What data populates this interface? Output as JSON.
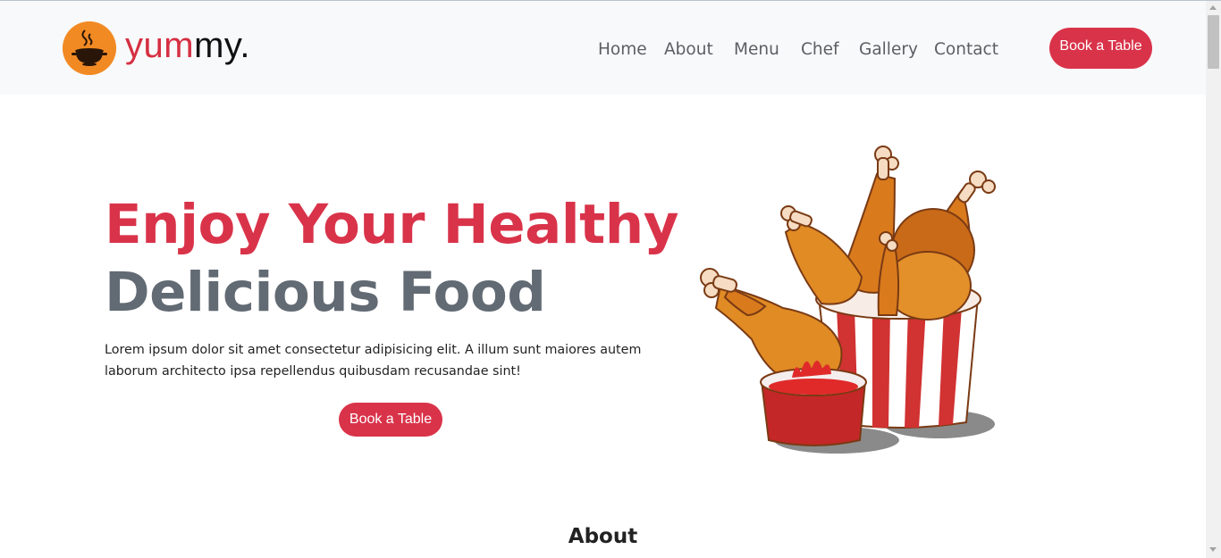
{
  "brand": {
    "logo_icon": "cooking-pot-icon",
    "name_part1": "yum",
    "name_part2": "my.",
    "logo_color": "#f28a24",
    "accent": "#d9334a"
  },
  "nav": {
    "items": [
      {
        "label": "Home"
      },
      {
        "label": "About"
      },
      {
        "label": "Menu"
      },
      {
        "label": "Chef"
      },
      {
        "label": "Gallery"
      },
      {
        "label": "Contact"
      }
    ],
    "cta_label": "Book a Table"
  },
  "hero": {
    "title_line1": "Enjoy Your Healthy",
    "title_line2": "Delicious Food",
    "description": "Lorem ipsum dolor sit amet consectetur adipisicing elit. A illum sunt maiores autem laborum architecto ipsa repellendus quibusdam recusandae sint!",
    "cta_label": "Book a Table",
    "image": "fried-chicken-bucket-illustration"
  },
  "about": {
    "heading": "About"
  }
}
